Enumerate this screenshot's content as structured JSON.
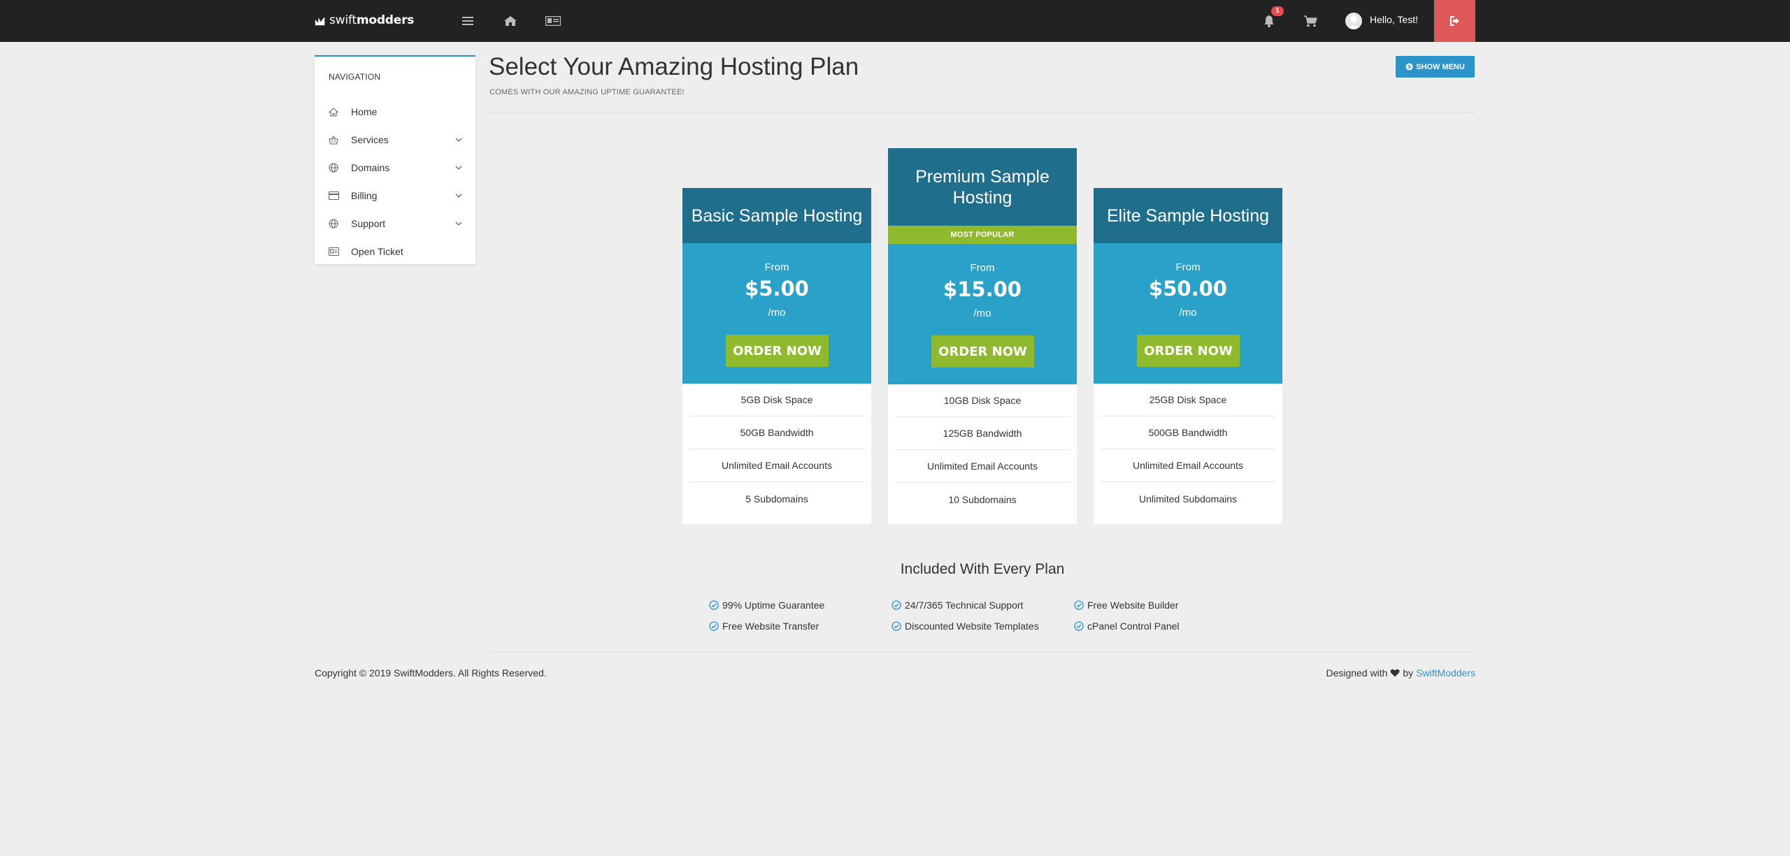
{
  "topbar": {
    "logo": {
      "light": "swift",
      "bold": "modders"
    },
    "notification_count": "1",
    "greeting": "Hello, Test!"
  },
  "sidebar": {
    "title": "NAVIGATION",
    "items": [
      {
        "label": "Home",
        "icon": "home-icon",
        "has_submenu": false
      },
      {
        "label": "Services",
        "icon": "basket-icon",
        "has_submenu": true
      },
      {
        "label": "Domains",
        "icon": "globe-icon",
        "has_submenu": true
      },
      {
        "label": "Billing",
        "icon": "credit-card-icon",
        "has_submenu": true
      },
      {
        "label": "Support",
        "icon": "globe-icon",
        "has_submenu": true
      },
      {
        "label": "Open Ticket",
        "icon": "ticket-icon",
        "has_submenu": false
      }
    ]
  },
  "header": {
    "title": "Select Your Amazing Hosting Plan",
    "subtitle": "COMES WITH OUR AMAZING UPTIME GUARANTEE!",
    "show_menu_label": "SHOW MENU"
  },
  "plans": [
    {
      "name": "Basic Sample Hosting",
      "from": "From",
      "price": "$5.00",
      "period": "/mo",
      "order_label": "ORDER NOW",
      "features": [
        "5GB Disk Space",
        "50GB Bandwidth",
        "Unlimited Email Accounts",
        "5 Subdomains"
      ]
    },
    {
      "name": "Premium Sample Hosting",
      "badge": "MOST POPULAR",
      "from": "From",
      "price": "$15.00",
      "period": "/mo",
      "order_label": "ORDER NOW",
      "features": [
        "10GB Disk Space",
        "125GB Bandwidth",
        "Unlimited Email Accounts",
        "10 Subdomains"
      ]
    },
    {
      "name": "Elite Sample Hosting",
      "from": "From",
      "price": "$50.00",
      "period": "/mo",
      "order_label": "ORDER NOW",
      "features": [
        "25GB Disk Space",
        "500GB Bandwidth",
        "Unlimited Email Accounts",
        "Unlimited Subdomains"
      ]
    }
  ],
  "included": {
    "title": "Included With Every Plan",
    "items": [
      "99% Uptime Guarantee",
      "24/7/365 Technical Support",
      "Free Website Builder",
      "Free Website Transfer",
      "Discounted Website Templates",
      "cPanel Control Panel"
    ]
  },
  "footer": {
    "copyright": "Copyright © 2019 SwiftModders. All Rights Reserved.",
    "designed_prefix": "Designed with",
    "designed_by": "by",
    "designed_link": "SwiftModders"
  },
  "colors": {
    "topbar": "#222222",
    "logout": "#e05757",
    "card_head": "#1e6e8c",
    "price_box": "#2aa1c8",
    "accent_green": "#90ba2e",
    "link_blue": "#2b95c9"
  }
}
